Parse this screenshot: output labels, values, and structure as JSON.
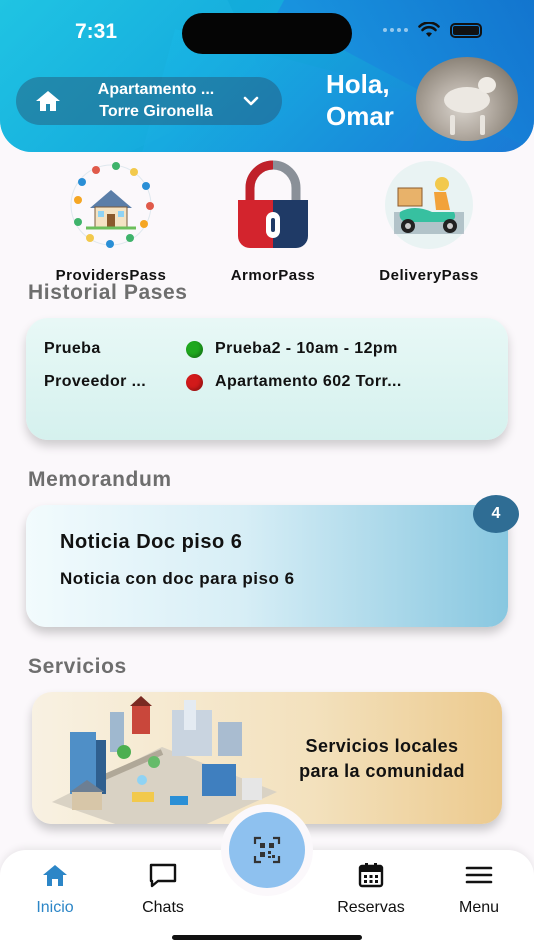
{
  "status": {
    "time": "7:31"
  },
  "header": {
    "location_line1": "Apartamento ...",
    "location_line2": "Torre Gironella",
    "greeting_line1": "Hola,",
    "greeting_line2": "Omar"
  },
  "shortcuts": [
    {
      "label": "ProvidersPass",
      "icon": "providers-icon"
    },
    {
      "label": "ArmorPass",
      "icon": "padlock-icon"
    },
    {
      "label": "DeliveryPass",
      "icon": "delivery-scooter-icon"
    }
  ],
  "history": {
    "title": "Historial Pases",
    "rows": [
      {
        "who": "Prueba",
        "status_color": "#1fa81f",
        "detail": "Prueba2  - 10am - 12pm"
      },
      {
        "who": "Proveedor ...",
        "status_color": "#d21a1a",
        "detail": "Apartamento 602 Torr..."
      }
    ]
  },
  "memo": {
    "title": "Memorandum",
    "badge": "4",
    "card_title": "Noticia Doc piso 6",
    "card_subtitle": "Noticia con doc para piso 6"
  },
  "services": {
    "title": "Servicios",
    "card_text_line1": "Servicios locales",
    "card_text_line2": "para la comunidad"
  },
  "tabbar": {
    "items": [
      {
        "label": "Inicio",
        "icon": "home-icon",
        "active": true
      },
      {
        "label": "Chats",
        "icon": "chat-icon",
        "active": false
      },
      {
        "label": "Reservas",
        "icon": "calendar-icon",
        "active": false
      },
      {
        "label": "Menu",
        "icon": "hamburger-icon",
        "active": false
      }
    ],
    "fab_icon": "qr-code-icon"
  },
  "colors": {
    "accent": "#2c86c7",
    "header": "#14a9dc",
    "fab": "#8ec1ef"
  }
}
